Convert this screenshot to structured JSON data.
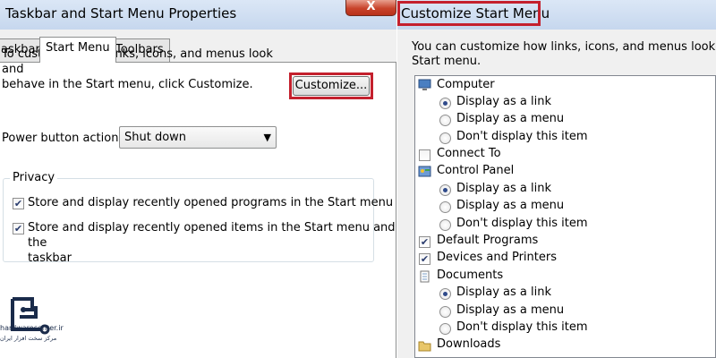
{
  "left_window": {
    "title": "Taskbar and Start Menu Properties",
    "close_label": "X",
    "tabs": [
      {
        "label": "askbar",
        "active": false
      },
      {
        "label": "Start Menu",
        "active": true
      },
      {
        "label": "Toolbars",
        "active": false
      }
    ],
    "description_line1": "To customize how links, icons, and menus look and",
    "description_line2": "behave in the Start menu, click Customize.",
    "customize_button": "Customize...",
    "power_label": "Power button action:",
    "power_value": "Shut down",
    "privacy": {
      "legend": "Privacy",
      "option1": "Store and display recently opened programs in the Start menu",
      "option2_line1": "Store and display recently opened items in the Start menu and the",
      "option2_line2": "taskbar"
    }
  },
  "right_window": {
    "title": "Customize Start Menu",
    "intro_line1": "You can customize how links, icons, and menus look and be",
    "intro_line2": "Start menu.",
    "items": {
      "computer": "Computer",
      "computer_link": "Display as a link",
      "computer_menu": "Display as a menu",
      "computer_none": "Don't display this item",
      "connect_to": "Connect To",
      "control_panel": "Control Panel",
      "cp_link": "Display as a link",
      "cp_menu": "Display as a menu",
      "cp_none": "Don't display this item",
      "default_programs": "Default Programs",
      "devices_printers": "Devices and Printers",
      "documents": "Documents",
      "doc_link": "Display as a link",
      "doc_menu": "Display as a menu",
      "doc_none": "Don't display this item",
      "downloads": "Downloads"
    }
  },
  "logo": {
    "site": "hardwarecenter.ir",
    "tagline": "مرکز سخت افزار ایران"
  }
}
